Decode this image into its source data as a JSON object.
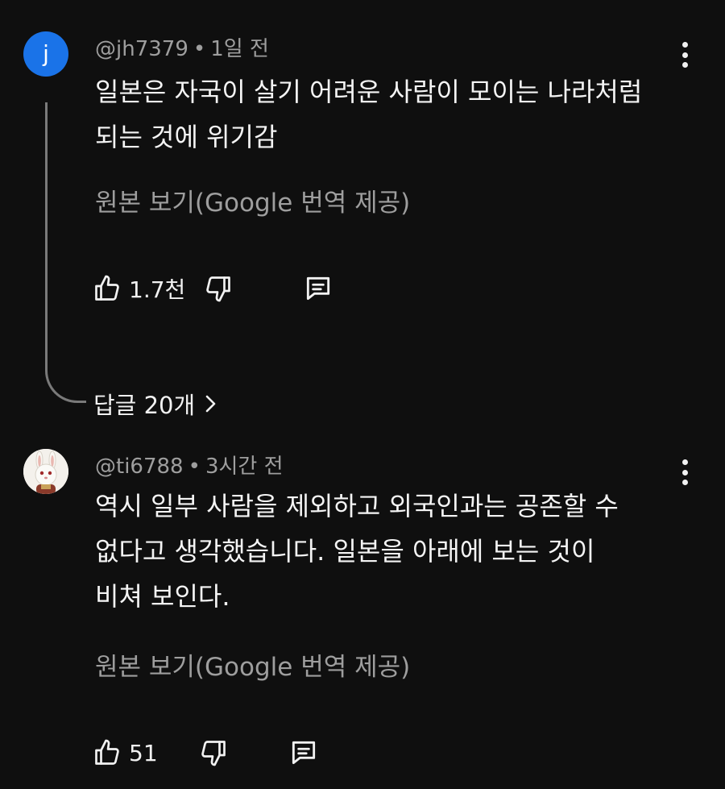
{
  "comments": [
    {
      "avatar_letter": "j",
      "avatar_color": "#1a73e8",
      "author": "@jh7379",
      "time": "1일 전",
      "lines": [
        "일본은 자국이 살기 어려운 사람이 모이는 나라처럼",
        "되는 것에 위기감"
      ],
      "translate_label": "원본 보기(Google 번역 제공)",
      "likes": "1.7천",
      "replies_label": "답글 20개"
    },
    {
      "avatar_icon": "rabbit-avatar-icon",
      "author": "@ti6788",
      "time": "3시간 전",
      "lines": [
        "역시 일부 사람을 제외하고 외국인과는 공존할 수",
        "없다고 생각했습니다. 일본을 아래에 보는 것이",
        "비쳐 보인다."
      ],
      "translate_label": "원본 보기(Google 번역 제공)",
      "likes": "51"
    }
  ],
  "colors": {
    "background": "#0f0f0f",
    "text": "#f1f1f1",
    "secondary_text": "#9e9e9e",
    "thread_line": "#7a7a7a"
  }
}
